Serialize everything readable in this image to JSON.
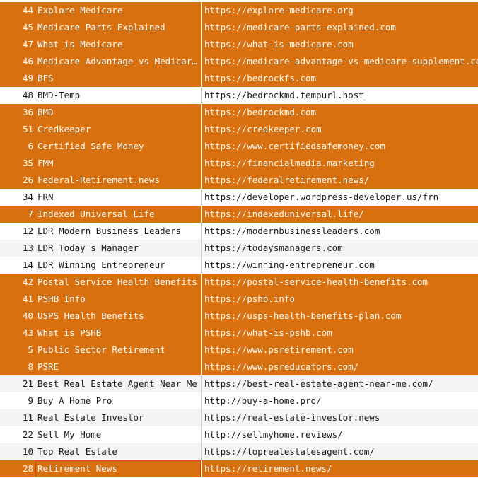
{
  "sites": [
    {
      "id": "44",
      "name": "Explore Medicare",
      "url": "https://explore-medicare.org",
      "style": "hl"
    },
    {
      "id": "45",
      "name": "Medicare Parts Explained",
      "url": "https://medicare-parts-explained.com",
      "style": "hl"
    },
    {
      "id": "47",
      "name": "What is Medicare",
      "url": "https://what-is-medicare.com",
      "style": "hl"
    },
    {
      "id": "46",
      "name": "Medicare Advantage vs Medicare…",
      "url": "https://medicare-advantage-vs-medicare-supplement.com",
      "style": "hl"
    },
    {
      "id": "49",
      "name": "BFS",
      "url": "https://bedrockfs.com",
      "style": "hl"
    },
    {
      "id": "48",
      "name": "BMD-Temp",
      "url": "https://bedrockmd.tempurl.host",
      "style": "white"
    },
    {
      "id": "36",
      "name": "BMD",
      "url": "https://bedrockmd.com",
      "style": "hl"
    },
    {
      "id": "51",
      "name": "Credkeeper",
      "url": "https://credkeeper.com",
      "style": "hl"
    },
    {
      "id": "6",
      "name": "Certified Safe Money",
      "url": "https://www.certifiedsafemoney.com",
      "style": "hl"
    },
    {
      "id": "35",
      "name": "FMM",
      "url": "https://financialmedia.marketing",
      "style": "hl"
    },
    {
      "id": "26",
      "name": "Federal-Retirement.news",
      "url": "https://federalretirement.news/",
      "style": "hl"
    },
    {
      "id": "34",
      "name": "FRN",
      "url": "https://developer.wordpress-developer.us/frn",
      "style": "white"
    },
    {
      "id": "7",
      "name": "Indexed Universal Life",
      "url": "https://indexeduniversal.life/",
      "style": "hl"
    },
    {
      "id": "12",
      "name": "LDR Modern Business Leaders",
      "url": "https://modernbusinessleaders.com",
      "style": "white"
    },
    {
      "id": "13",
      "name": "LDR Today's Manager",
      "url": "https://todaysmanagers.com",
      "style": "gray"
    },
    {
      "id": "14",
      "name": "LDR Winning Entrepreneur",
      "url": "https://winning-entrepreneur.com",
      "style": "white"
    },
    {
      "id": "42",
      "name": "Postal Service Health Benefits",
      "url": "https://postal-service-health-benefits.com",
      "style": "hl"
    },
    {
      "id": "41",
      "name": "PSHB Info",
      "url": "https://pshb.info",
      "style": "hl"
    },
    {
      "id": "40",
      "name": "USPS Health Benefits",
      "url": "https://usps-health-benefits-plan.com",
      "style": "hl"
    },
    {
      "id": "43",
      "name": "What is PSHB",
      "url": "https://what-is-pshb.com",
      "style": "hl"
    },
    {
      "id": "5",
      "name": "Public Sector Retirement",
      "url": "https://www.psretirement.com",
      "style": "hl"
    },
    {
      "id": "8",
      "name": "PSRE",
      "url": "https://www.psreducators.com/",
      "style": "hl"
    },
    {
      "id": "21",
      "name": "Best Real Estate Agent Near Me",
      "url": "https://best-real-estate-agent-near-me.com/",
      "style": "gray"
    },
    {
      "id": "9",
      "name": "Buy A Home Pro",
      "url": "http://buy-a-home.pro/",
      "style": "white"
    },
    {
      "id": "11",
      "name": "Real Estate Investor",
      "url": "https://real-estate-investor.news",
      "style": "gray"
    },
    {
      "id": "22",
      "name": "Sell My Home",
      "url": "http://sellmyhome.reviews/",
      "style": "white"
    },
    {
      "id": "10",
      "name": "Top Real Estate",
      "url": "https://toprealestatesagent.com/",
      "style": "gray"
    },
    {
      "id": "28",
      "name": "Retirement News",
      "url": "https://retirement.news/",
      "style": "hl",
      "selected": true
    }
  ]
}
